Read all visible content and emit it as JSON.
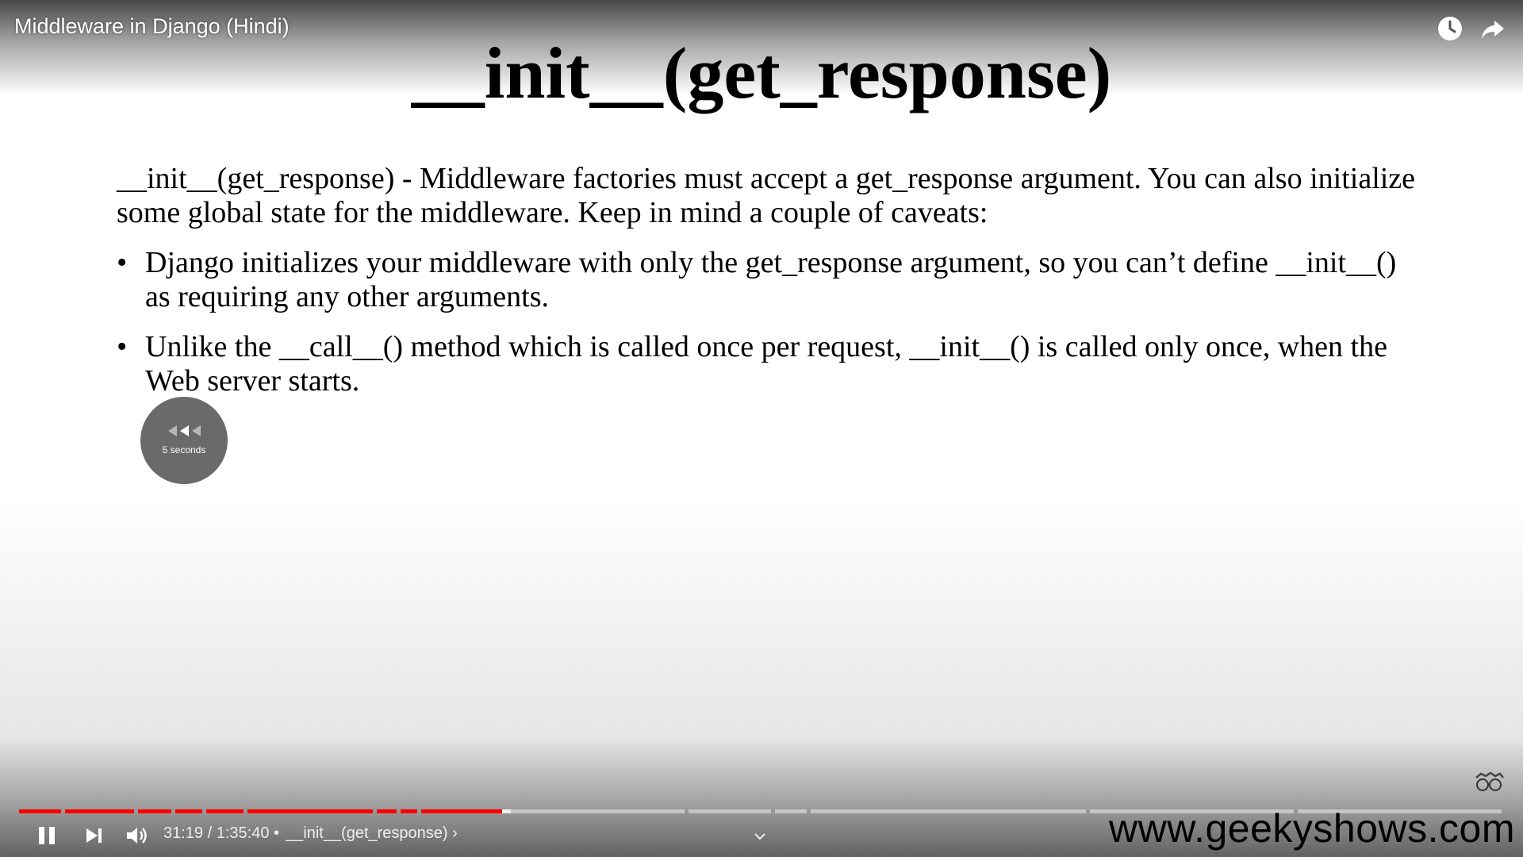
{
  "player": {
    "video_title": "Middleware in Django (Hindi)",
    "time": "31:19 / 1:35:40",
    "separator": "•",
    "chapter": "__init__(get_response)",
    "chapter_chevron": "›",
    "progress_fraction": 0.327,
    "buffer_fraction": 0.333,
    "seek_text": "5 seconds",
    "accent": "#ff0000",
    "icons": [
      "watch-later-icon",
      "share-icon",
      "pause-icon",
      "next-icon",
      "volume-icon",
      "chevron-down-icon"
    ]
  },
  "slide": {
    "title": "__init__(get_response)",
    "intro": "__init__(get_response) - Middleware factories must accept a get_response argument. You can also initialize some global state for the middleware. Keep in mind a couple of caveats:",
    "bullets": [
      "Django initializes your middleware with only the get_response argument, so you can’t define __init__() as requiring any other arguments.",
      "Unlike the __call__() method which is called once per request, __init__() is called only once, when the Web server starts."
    ],
    "bullet_char": "•"
  },
  "watermark": "www.geekyshows.com"
}
